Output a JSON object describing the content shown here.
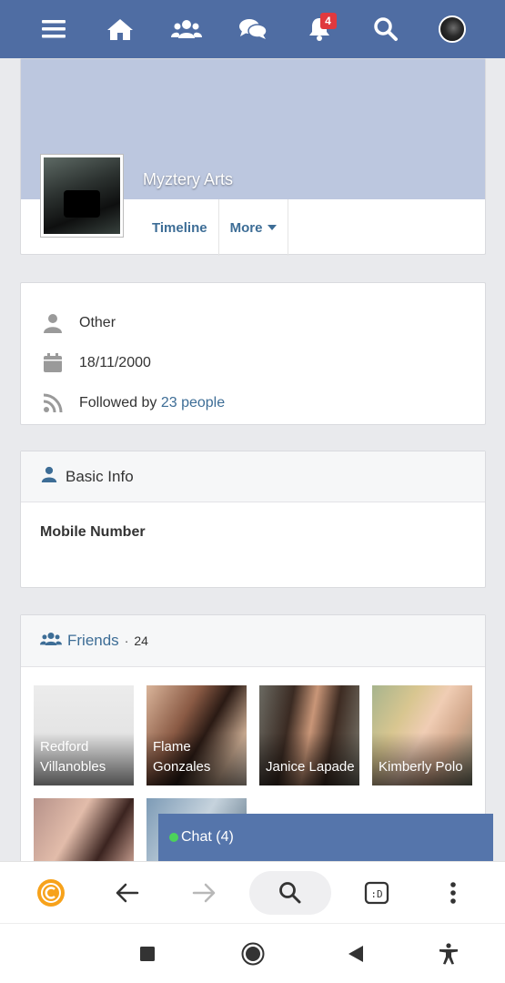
{
  "topbar": {
    "notification_count": "4",
    "icons": [
      "menu-icon",
      "home-icon",
      "users-icon",
      "chat-bubbles-icon",
      "bell-icon",
      "search-icon",
      "user-avatar"
    ]
  },
  "profile": {
    "name": "Myztery Arts",
    "tabs": {
      "timeline": "Timeline",
      "more": "More"
    }
  },
  "info": {
    "gender": "Other",
    "birthdate": "18/11/2000",
    "followed_prefix": "Followed by",
    "followed_link": "23 people"
  },
  "basic_info": {
    "title": "Basic Info",
    "field_label": "Mobile Number"
  },
  "friends": {
    "title": "Friends",
    "separator": "·",
    "count": "24",
    "items": [
      {
        "name": "Redford Villanobles"
      },
      {
        "name": "Flame Gonzales"
      },
      {
        "name": "Janice Lapade"
      },
      {
        "name": "Kimberly Polo"
      }
    ]
  },
  "chat": {
    "label": "Chat (4)",
    "status_color": "#4cd25a"
  },
  "colors": {
    "topbar": "#4f6da3",
    "link": "#3d6d96",
    "chat_bar": "#5575ab",
    "badge": "#e0393e"
  }
}
